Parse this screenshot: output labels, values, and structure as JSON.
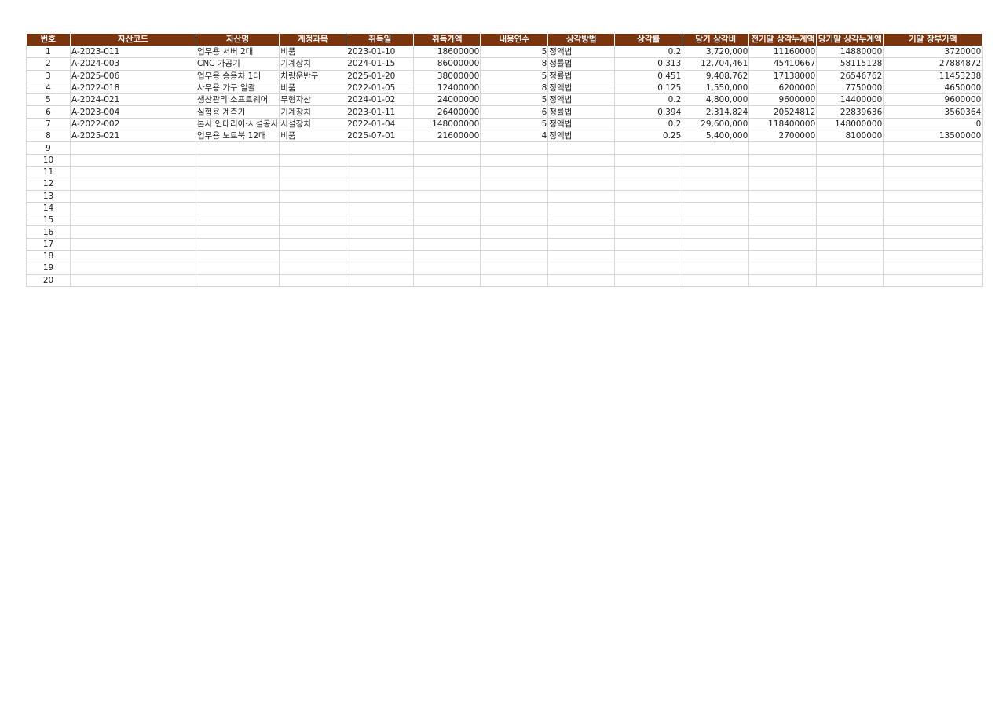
{
  "sheet": {
    "header_bg": "#7a340e",
    "header_fg": "#ffffff",
    "columns": [
      {
        "label": "번호",
        "align": "c"
      },
      {
        "label": "자산코드",
        "align": "l"
      },
      {
        "label": "자산명",
        "align": "l"
      },
      {
        "label": "계정과목",
        "align": "l"
      },
      {
        "label": "취득일",
        "align": "l"
      },
      {
        "label": "취득가액",
        "align": "r"
      },
      {
        "label": "내용연수",
        "align": "r"
      },
      {
        "label": "상각방법",
        "align": "l"
      },
      {
        "label": "상각률",
        "align": "r"
      },
      {
        "label": "당기 상각비",
        "align": "r"
      },
      {
        "label": "전기말 상각누계액",
        "align": "r"
      },
      {
        "label": "당기말 상각누계액",
        "align": "r"
      },
      {
        "label": "기말 장부가액",
        "align": "r"
      }
    ],
    "rows": [
      [
        "1",
        "A-2023-011",
        "업무용 서버 2대",
        "비품",
        "2023-01-10",
        "18600000",
        "5",
        "정액법",
        "0.2",
        "3,720,000",
        "11160000",
        "14880000",
        "3720000"
      ],
      [
        "2",
        "A-2024-003",
        "CNC 가공기",
        "기계장치",
        "2024-01-15",
        "86000000",
        "8",
        "정률법",
        "0.313",
        "12,704,461",
        "45410667",
        "58115128",
        "27884872"
      ],
      [
        "3",
        "A-2025-006",
        "업무용 승용차 1대",
        "차량운반구",
        "2025-01-20",
        "38000000",
        "5",
        "정률법",
        "0.451",
        "9,408,762",
        "17138000",
        "26546762",
        "11453238"
      ],
      [
        "4",
        "A-2022-018",
        "사무용 가구 일괄",
        "비품",
        "2022-01-05",
        "12400000",
        "8",
        "정액법",
        "0.125",
        "1,550,000",
        "6200000",
        "7750000",
        "4650000"
      ],
      [
        "5",
        "A-2024-021",
        "생산관리 소프트웨어",
        "무형자산",
        "2024-01-02",
        "24000000",
        "5",
        "정액법",
        "0.2",
        "4,800,000",
        "9600000",
        "14400000",
        "9600000"
      ],
      [
        "6",
        "A-2023-004",
        "실험용 계측기",
        "기계장치",
        "2023-01-11",
        "26400000",
        "6",
        "정률법",
        "0.394",
        "2,314,824",
        "20524812",
        "22839636",
        "3560364"
      ],
      [
        "7",
        "A-2022-002",
        "본사 인테리어·시설공사",
        "시설장치",
        "2022-01-04",
        "148000000",
        "5",
        "정액법",
        "0.2",
        "29,600,000",
        "118400000",
        "148000000",
        "0"
      ],
      [
        "8",
        "A-2025-021",
        "업무용 노트북 12대",
        "비품",
        "2025-07-01",
        "21600000",
        "4",
        "정액법",
        "0.25",
        "5,400,000",
        "2700000",
        "8100000",
        "13500000"
      ],
      [
        "9",
        "",
        "",
        "",
        "",
        "",
        "",
        "",
        "",
        "",
        "",
        "",
        ""
      ],
      [
        "10",
        "",
        "",
        "",
        "",
        "",
        "",
        "",
        "",
        "",
        "",
        "",
        ""
      ],
      [
        "11",
        "",
        "",
        "",
        "",
        "",
        "",
        "",
        "",
        "",
        "",
        "",
        ""
      ],
      [
        "12",
        "",
        "",
        "",
        "",
        "",
        "",
        "",
        "",
        "",
        "",
        "",
        ""
      ],
      [
        "13",
        "",
        "",
        "",
        "",
        "",
        "",
        "",
        "",
        "",
        "",
        "",
        ""
      ],
      [
        "14",
        "",
        "",
        "",
        "",
        "",
        "",
        "",
        "",
        "",
        "",
        "",
        ""
      ],
      [
        "15",
        "",
        "",
        "",
        "",
        "",
        "",
        "",
        "",
        "",
        "",
        "",
        ""
      ],
      [
        "16",
        "",
        "",
        "",
        "",
        "",
        "",
        "",
        "",
        "",
        "",
        "",
        ""
      ],
      [
        "17",
        "",
        "",
        "",
        "",
        "",
        "",
        "",
        "",
        "",
        "",
        "",
        ""
      ],
      [
        "18",
        "",
        "",
        "",
        "",
        "",
        "",
        "",
        "",
        "",
        "",
        "",
        ""
      ],
      [
        "19",
        "",
        "",
        "",
        "",
        "",
        "",
        "",
        "",
        "",
        "",
        "",
        ""
      ],
      [
        "20",
        "",
        "",
        "",
        "",
        "",
        "",
        "",
        "",
        "",
        "",
        "",
        ""
      ]
    ]
  }
}
